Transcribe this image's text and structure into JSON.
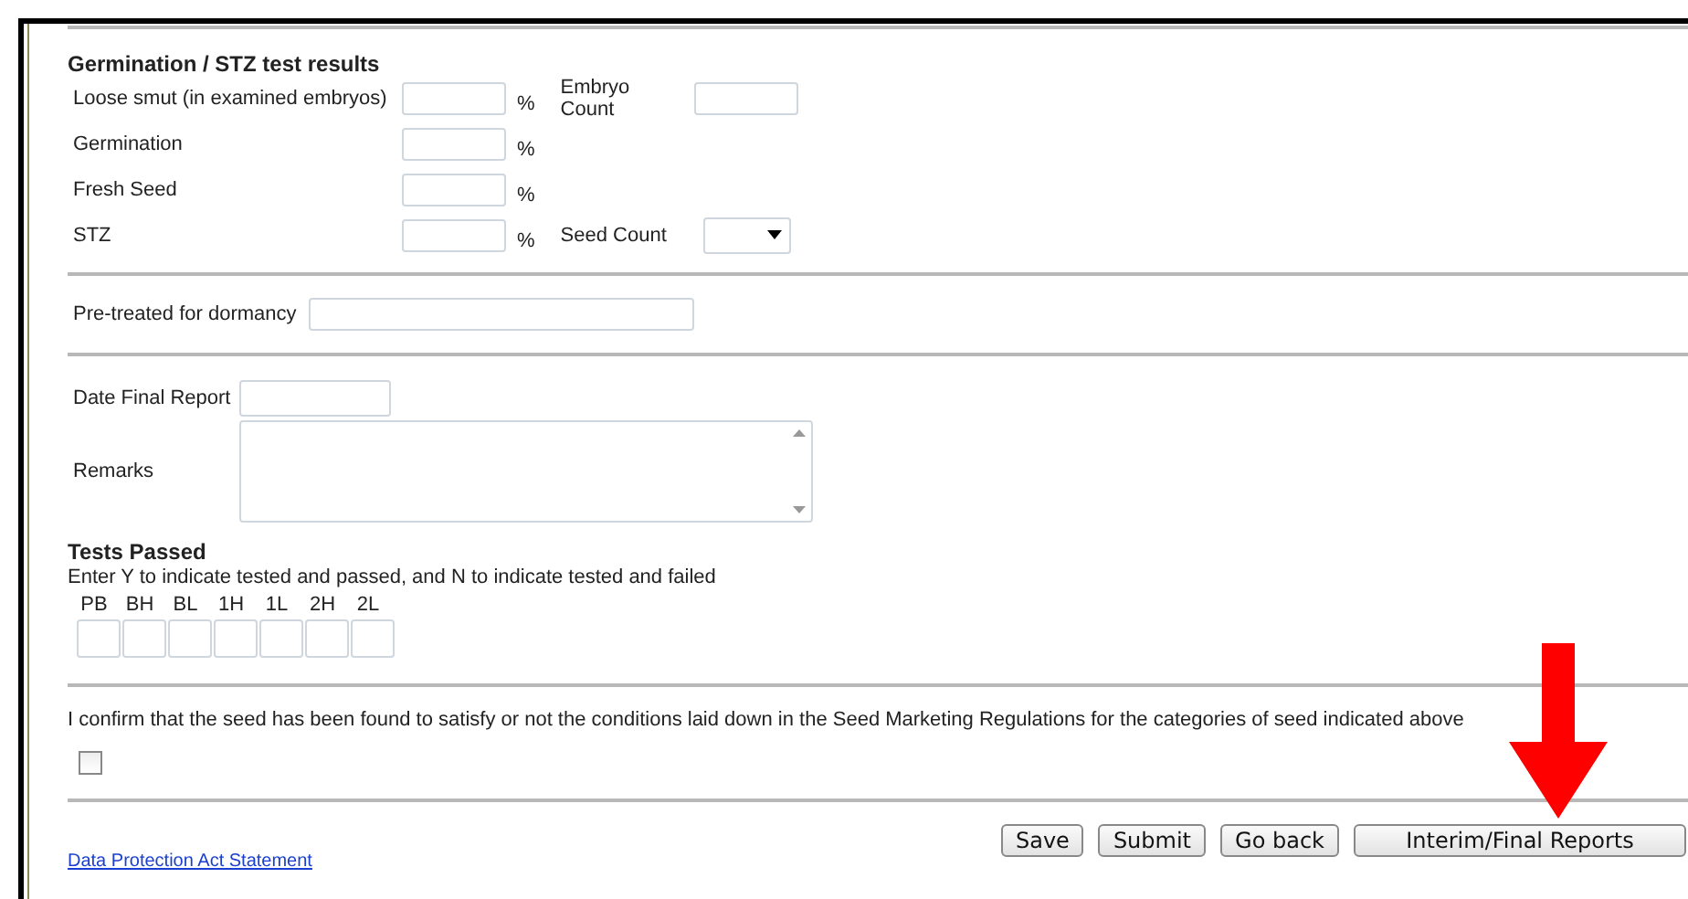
{
  "section": {
    "title": "Germination / STZ test results"
  },
  "results": [
    {
      "label": "Loose smut (in examined embryos)",
      "unit": "%",
      "extra": {
        "kind": "input",
        "label": "Embryo Count"
      }
    },
    {
      "label": "Germination",
      "unit": "%"
    },
    {
      "label": "Fresh Seed",
      "unit": "%"
    },
    {
      "label": "STZ",
      "unit": "%",
      "extra": {
        "kind": "select",
        "label": "Seed Count"
      }
    }
  ],
  "pretreated": {
    "label": "Pre-treated for dormancy"
  },
  "date_final_report": {
    "label": "Date Final Report"
  },
  "remarks": {
    "label": "Remarks"
  },
  "tests_passed": {
    "title": "Tests Passed",
    "instructions": "Enter Y to indicate tested and passed, and N to indicate tested and failed",
    "codes": [
      "PB",
      "BH",
      "BL",
      "1H",
      "1L",
      "2H",
      "2L"
    ]
  },
  "confirmation": {
    "text": "I confirm that the seed has been found to satisfy or not the conditions laid down in the Seed Marketing Regulations for the categories of seed indicated above",
    "checked": false
  },
  "footer_link": "Data Protection Act Statement",
  "buttons": [
    "Save",
    "Submit",
    "Go back",
    "Interim/Final Reports"
  ]
}
